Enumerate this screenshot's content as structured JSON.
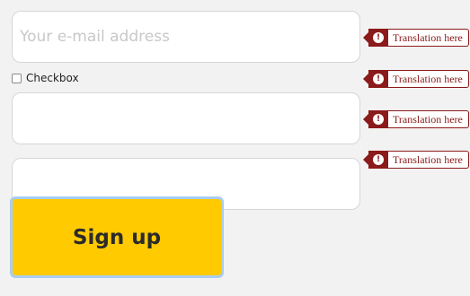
{
  "form": {
    "email": {
      "value": "",
      "placeholder": "Your e-mail address"
    },
    "checkbox": {
      "label": "Checkbox",
      "checked": false
    },
    "field2": {
      "value": "",
      "placeholder": ""
    },
    "field3": {
      "value": "",
      "placeholder": ""
    },
    "submit_label": "Sign up"
  },
  "tooltips": [
    {
      "icon": "exclamation-icon",
      "text": "Translation here"
    },
    {
      "icon": "exclamation-icon",
      "text": "Translation here"
    },
    {
      "icon": "exclamation-icon",
      "text": "Translation here"
    },
    {
      "icon": "exclamation-icon",
      "text": "Translation here"
    }
  ],
  "colors": {
    "background": "#f2f2f2",
    "button": "#ffca00",
    "button_focus_ring": "#a9cdf2",
    "error": "#8b1a1a"
  }
}
